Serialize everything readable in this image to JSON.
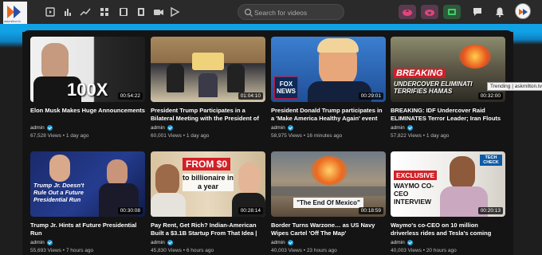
{
  "app": {
    "logo_text": "askmilton.tv",
    "search_placeholder": "Search for videos"
  },
  "toolbar": {
    "icons": [
      "video-library-icon",
      "bar-chart-icon",
      "trending-icon",
      "grid-icon",
      "film-icon",
      "camera-icon",
      "play-icon"
    ],
    "right_icons": [
      "upload-cloud-icon",
      "download-cloud-icon",
      "live-icon",
      "message-icon",
      "notification-bell-icon",
      "user-avatar-icon"
    ]
  },
  "tooltip": "Trending | askmilton.tv",
  "videos": [
    {
      "title": "Elon Musk Makes Huge Announcements",
      "author": "admin",
      "views": "67,528 Views",
      "age": "1 day ago",
      "duration": "00:54:22",
      "thumb_text": "100X"
    },
    {
      "title": "President Trump Participates in a Bilateral Meeting with the President of South Africa",
      "author": "admin",
      "views": "60,001 Views",
      "age": "1 day ago",
      "duration": "01:04:10",
      "thumb_text": ""
    },
    {
      "title": "President Donald Trump participates in a 'Make America Healthy Again' event",
      "author": "admin",
      "views": "58,975 Views",
      "age": "16 minutes ago",
      "duration": "00:29:01",
      "thumb_text": "FOX NEWS"
    },
    {
      "title": "BREAKING: IDF Undercover Raid ELIMINATES Terror Leader; Iran Flouts",
      "author": "admin",
      "views": "57,822 Views",
      "age": "1 day ago",
      "duration": "00:32:00",
      "thumb_text": "BREAKING",
      "thumb_sub": "UNDERCOVER ELIMINATI TERRIFIES HAMAS"
    },
    {
      "title": "Trump Jr. Hints at Future Presidential Run",
      "author": "admin",
      "views": "55,693 Views",
      "age": "7 hours ago",
      "duration": "00:30:08",
      "thumb_text": "Trump Jr. Doesn't Rule Out a Future Presidential Run"
    },
    {
      "title": "Pay Rent, Get Rich? Indian-American Built a $3.1B Startup From That Idea | Ankur",
      "author": "admin",
      "views": "45,830 Views",
      "age": "6 hours ago",
      "duration": "00:28:14",
      "thumb_text": "FROM $0",
      "thumb_sub": "to billionaire in a year"
    },
    {
      "title": "Border Turns Warzone… as US Navy Wipes Cartel 'Off The Map'",
      "author": "admin",
      "views": "40,003 Views",
      "age": "23 hours ago",
      "duration": "00:18:59",
      "thumb_text": "\"The End Of Mexico\""
    },
    {
      "title": "Waymo's co-CEO on 10 million driverless rides and Tesla's coming robotaxi",
      "author": "admin",
      "views": "40,003 Views",
      "age": "20 hours ago",
      "duration": "00:20:13",
      "thumb_text": "EXCLUSIVE",
      "thumb_sub": "WAYMO CO-CEO INTERVIEW",
      "thumb_badge": "TECH CHECK"
    }
  ],
  "colors": {
    "accent_blue": "#11a2e6",
    "background": "#1e1e1e",
    "verified": "#1a9ad6",
    "upload_pill": "#5a3a4e",
    "live_pill": "#2e5a3a"
  }
}
